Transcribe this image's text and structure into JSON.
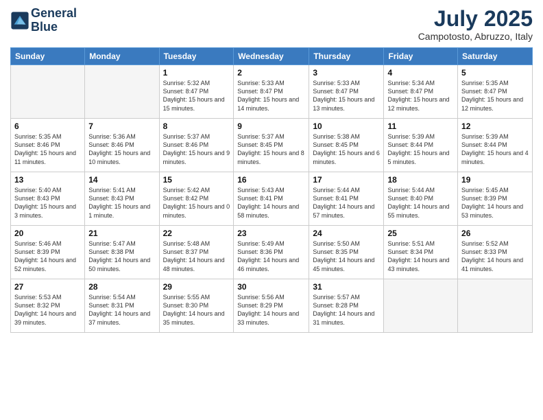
{
  "logo": {
    "line1": "General",
    "line2": "Blue"
  },
  "title": "July 2025",
  "subtitle": "Campotosto, Abruzzo, Italy",
  "days_of_week": [
    "Sunday",
    "Monday",
    "Tuesday",
    "Wednesday",
    "Thursday",
    "Friday",
    "Saturday"
  ],
  "weeks": [
    [
      {
        "day": "",
        "info": ""
      },
      {
        "day": "",
        "info": ""
      },
      {
        "day": "1",
        "info": "Sunrise: 5:32 AM\nSunset: 8:47 PM\nDaylight: 15 hours and 15 minutes."
      },
      {
        "day": "2",
        "info": "Sunrise: 5:33 AM\nSunset: 8:47 PM\nDaylight: 15 hours and 14 minutes."
      },
      {
        "day": "3",
        "info": "Sunrise: 5:33 AM\nSunset: 8:47 PM\nDaylight: 15 hours and 13 minutes."
      },
      {
        "day": "4",
        "info": "Sunrise: 5:34 AM\nSunset: 8:47 PM\nDaylight: 15 hours and 12 minutes."
      },
      {
        "day": "5",
        "info": "Sunrise: 5:35 AM\nSunset: 8:47 PM\nDaylight: 15 hours and 12 minutes."
      }
    ],
    [
      {
        "day": "6",
        "info": "Sunrise: 5:35 AM\nSunset: 8:46 PM\nDaylight: 15 hours and 11 minutes."
      },
      {
        "day": "7",
        "info": "Sunrise: 5:36 AM\nSunset: 8:46 PM\nDaylight: 15 hours and 10 minutes."
      },
      {
        "day": "8",
        "info": "Sunrise: 5:37 AM\nSunset: 8:46 PM\nDaylight: 15 hours and 9 minutes."
      },
      {
        "day": "9",
        "info": "Sunrise: 5:37 AM\nSunset: 8:45 PM\nDaylight: 15 hours and 8 minutes."
      },
      {
        "day": "10",
        "info": "Sunrise: 5:38 AM\nSunset: 8:45 PM\nDaylight: 15 hours and 6 minutes."
      },
      {
        "day": "11",
        "info": "Sunrise: 5:39 AM\nSunset: 8:44 PM\nDaylight: 15 hours and 5 minutes."
      },
      {
        "day": "12",
        "info": "Sunrise: 5:39 AM\nSunset: 8:44 PM\nDaylight: 15 hours and 4 minutes."
      }
    ],
    [
      {
        "day": "13",
        "info": "Sunrise: 5:40 AM\nSunset: 8:43 PM\nDaylight: 15 hours and 3 minutes."
      },
      {
        "day": "14",
        "info": "Sunrise: 5:41 AM\nSunset: 8:43 PM\nDaylight: 15 hours and 1 minute."
      },
      {
        "day": "15",
        "info": "Sunrise: 5:42 AM\nSunset: 8:42 PM\nDaylight: 15 hours and 0 minutes."
      },
      {
        "day": "16",
        "info": "Sunrise: 5:43 AM\nSunset: 8:41 PM\nDaylight: 14 hours and 58 minutes."
      },
      {
        "day": "17",
        "info": "Sunrise: 5:44 AM\nSunset: 8:41 PM\nDaylight: 14 hours and 57 minutes."
      },
      {
        "day": "18",
        "info": "Sunrise: 5:44 AM\nSunset: 8:40 PM\nDaylight: 14 hours and 55 minutes."
      },
      {
        "day": "19",
        "info": "Sunrise: 5:45 AM\nSunset: 8:39 PM\nDaylight: 14 hours and 53 minutes."
      }
    ],
    [
      {
        "day": "20",
        "info": "Sunrise: 5:46 AM\nSunset: 8:39 PM\nDaylight: 14 hours and 52 minutes."
      },
      {
        "day": "21",
        "info": "Sunrise: 5:47 AM\nSunset: 8:38 PM\nDaylight: 14 hours and 50 minutes."
      },
      {
        "day": "22",
        "info": "Sunrise: 5:48 AM\nSunset: 8:37 PM\nDaylight: 14 hours and 48 minutes."
      },
      {
        "day": "23",
        "info": "Sunrise: 5:49 AM\nSunset: 8:36 PM\nDaylight: 14 hours and 46 minutes."
      },
      {
        "day": "24",
        "info": "Sunrise: 5:50 AM\nSunset: 8:35 PM\nDaylight: 14 hours and 45 minutes."
      },
      {
        "day": "25",
        "info": "Sunrise: 5:51 AM\nSunset: 8:34 PM\nDaylight: 14 hours and 43 minutes."
      },
      {
        "day": "26",
        "info": "Sunrise: 5:52 AM\nSunset: 8:33 PM\nDaylight: 14 hours and 41 minutes."
      }
    ],
    [
      {
        "day": "27",
        "info": "Sunrise: 5:53 AM\nSunset: 8:32 PM\nDaylight: 14 hours and 39 minutes."
      },
      {
        "day": "28",
        "info": "Sunrise: 5:54 AM\nSunset: 8:31 PM\nDaylight: 14 hours and 37 minutes."
      },
      {
        "day": "29",
        "info": "Sunrise: 5:55 AM\nSunset: 8:30 PM\nDaylight: 14 hours and 35 minutes."
      },
      {
        "day": "30",
        "info": "Sunrise: 5:56 AM\nSunset: 8:29 PM\nDaylight: 14 hours and 33 minutes."
      },
      {
        "day": "31",
        "info": "Sunrise: 5:57 AM\nSunset: 8:28 PM\nDaylight: 14 hours and 31 minutes."
      },
      {
        "day": "",
        "info": ""
      },
      {
        "day": "",
        "info": ""
      }
    ]
  ]
}
